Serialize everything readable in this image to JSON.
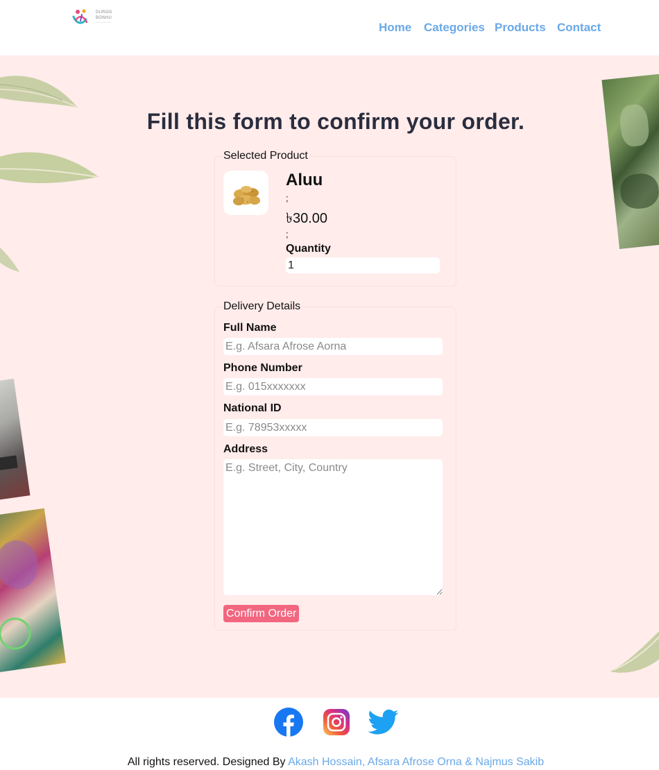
{
  "header": {
    "logo": {
      "line1": "DUROG",
      "line2": "BONHU",
      "line3": "••••• ••••• •••••"
    },
    "nav": [
      {
        "label": "Home"
      },
      {
        "label": "Categories"
      },
      {
        "label": "Products"
      },
      {
        "label": "Contact"
      }
    ]
  },
  "main": {
    "title": "Fill this form to confirm your order.",
    "selected_product": {
      "legend": "Selected Product",
      "image_icon": "potato-image",
      "name": "Aluu",
      "separator": ";",
      "price": "৳30.00",
      "quantity_label": "Quantity",
      "quantity_value": "1"
    },
    "delivery": {
      "legend": "Delivery Details",
      "full_name_label": "Full Name",
      "full_name_placeholder": "E.g. Afsara Afrose Aorna",
      "phone_label": "Phone Number",
      "phone_placeholder": "E.g. 015xxxxxxx",
      "nid_label": "National ID",
      "nid_placeholder": "E.g. 78953xxxxx",
      "address_label": "Address",
      "address_placeholder": "E.g. Street, City, Country",
      "confirm_label": "Confirm Order"
    }
  },
  "footer": {
    "social_icons": [
      "facebook-icon",
      "instagram-icon",
      "twitter-icon"
    ],
    "copyright_prefix": "All rights reserved. Designed By ",
    "designers": "Akash Hossain, Afsara Afrose Orna & Najmus Sakib"
  },
  "colors": {
    "accent": "#6aa8e8",
    "background_pink": "#ffeceb",
    "button": "#f26680",
    "title": "#2a2d3e"
  }
}
